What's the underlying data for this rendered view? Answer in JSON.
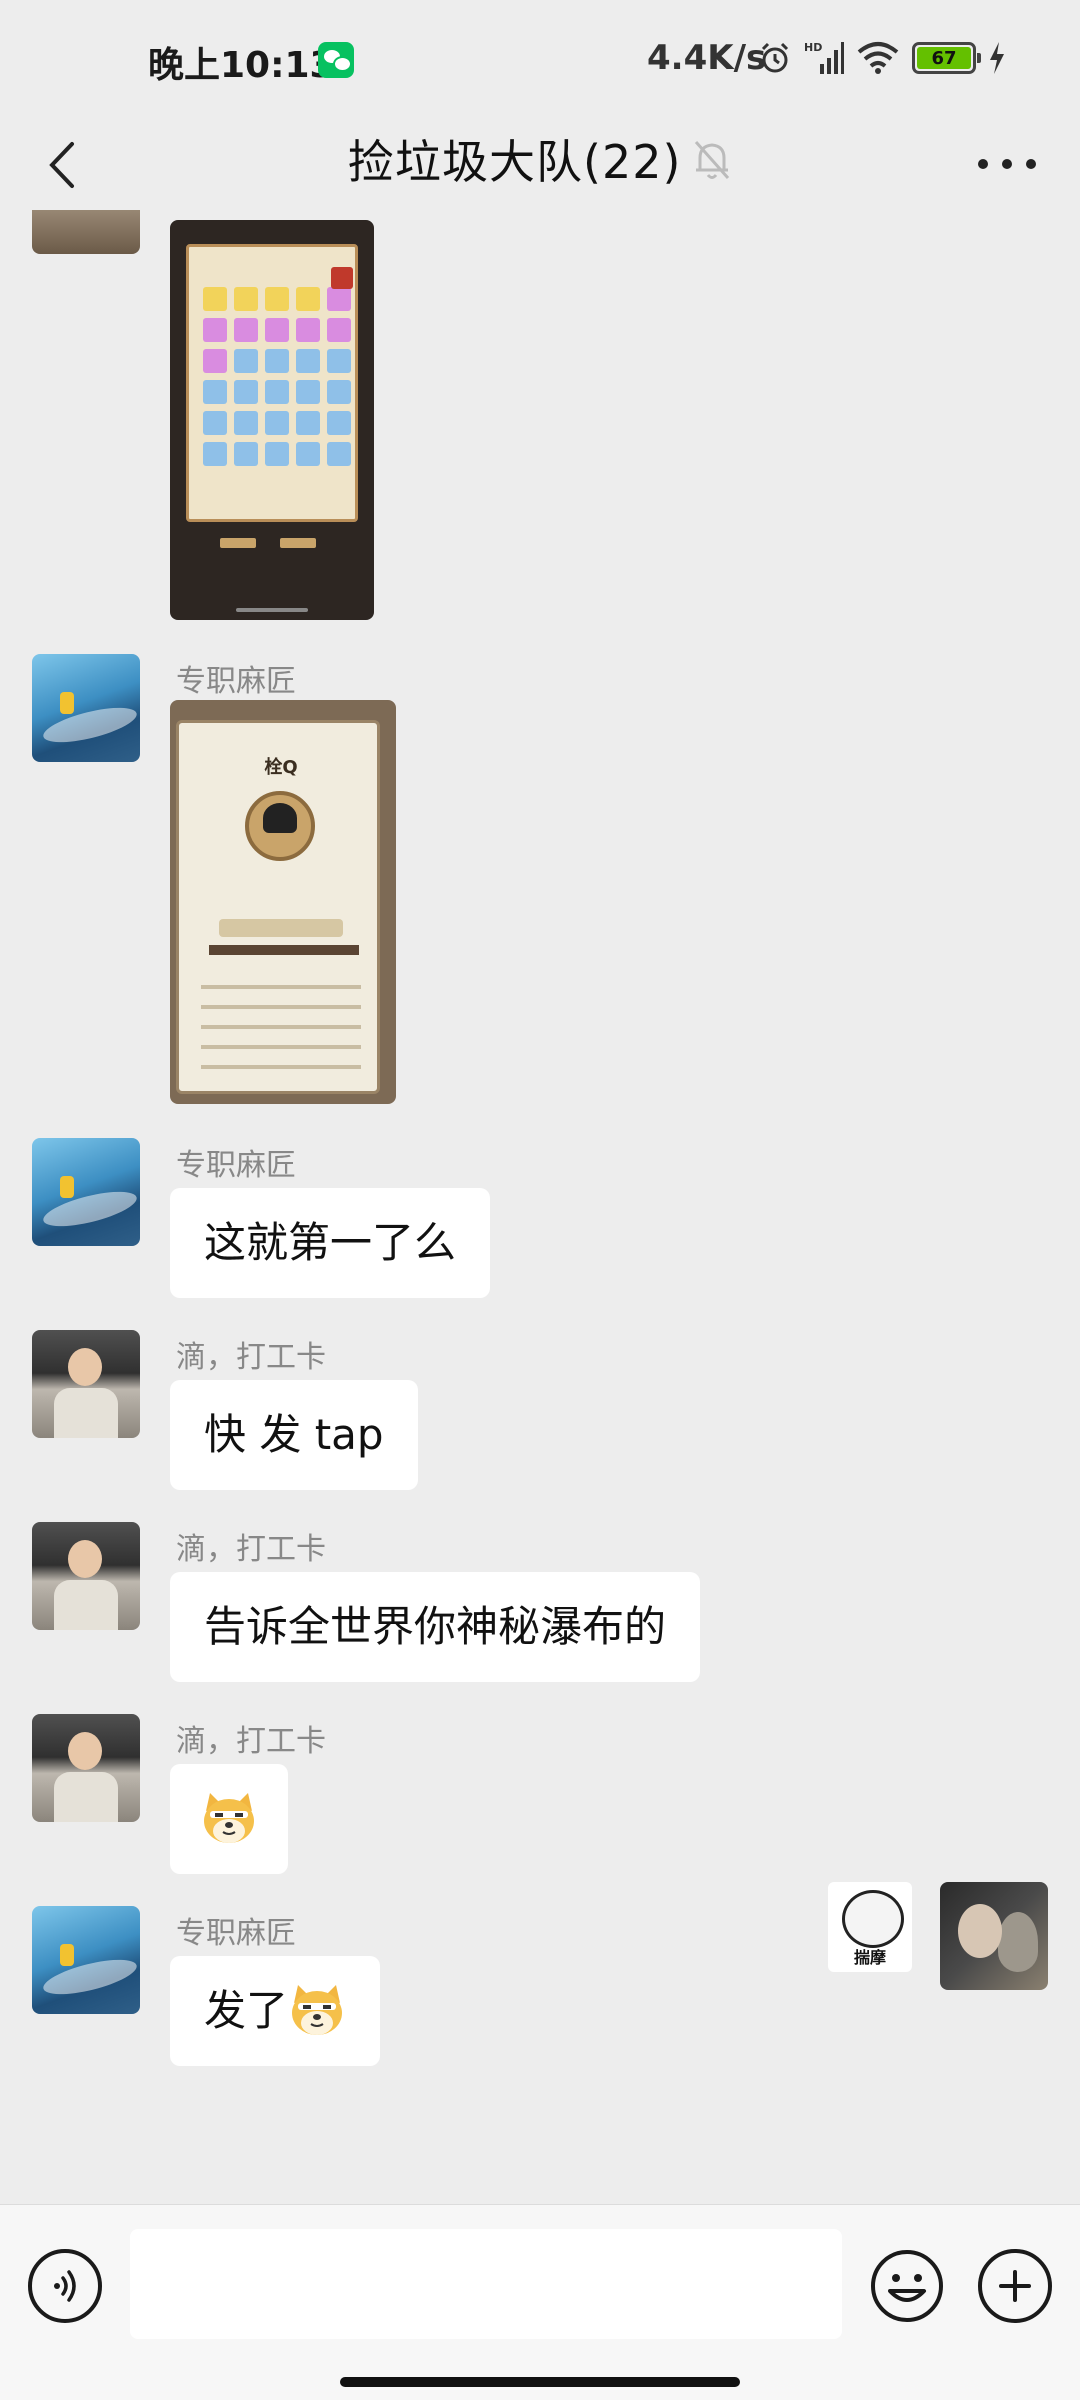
{
  "status_bar": {
    "time": "晚上10:13",
    "net_speed": "4.4K/s",
    "battery_level": "67",
    "icons": [
      "wechat-icon",
      "alarm-icon",
      "signal-icon",
      "wifi-icon",
      "battery-icon",
      "charging-icon"
    ]
  },
  "header": {
    "title": "捡垃圾大队(22)",
    "back_icon": "chevron-left-icon",
    "mute_icon": "bell-muted-icon",
    "more_icon": "more-icon"
  },
  "screenshot_2": {
    "player_name": "栓Q"
  },
  "messages": [
    {
      "type": "image",
      "sender": "",
      "image": "game-warehouse-screenshot"
    },
    {
      "type": "image",
      "sender": "专职麻匠",
      "image": "game-profile-screenshot"
    },
    {
      "type": "text",
      "sender": "专职麻匠",
      "text": "这就第一了么"
    },
    {
      "type": "text",
      "sender": "滴，打工卡",
      "text": "快 发 tap"
    },
    {
      "type": "text",
      "sender": "滴，打工卡",
      "text": "告诉全世界你神秘瀑布的"
    },
    {
      "type": "emoji",
      "sender": "滴，打工卡",
      "text": "",
      "emoji": "doge-emoji"
    },
    {
      "type": "text",
      "sender": "专职麻匠",
      "text": "发了",
      "emoji": "doge-emoji"
    }
  ],
  "self_sticker": {
    "label": "揣摩"
  },
  "input_bar": {
    "value": "",
    "placeholder": ""
  },
  "colors": {
    "background": "#ededed",
    "bubble": "#ffffff",
    "wechat_green": "#07c160",
    "battery_green": "#64c000"
  }
}
